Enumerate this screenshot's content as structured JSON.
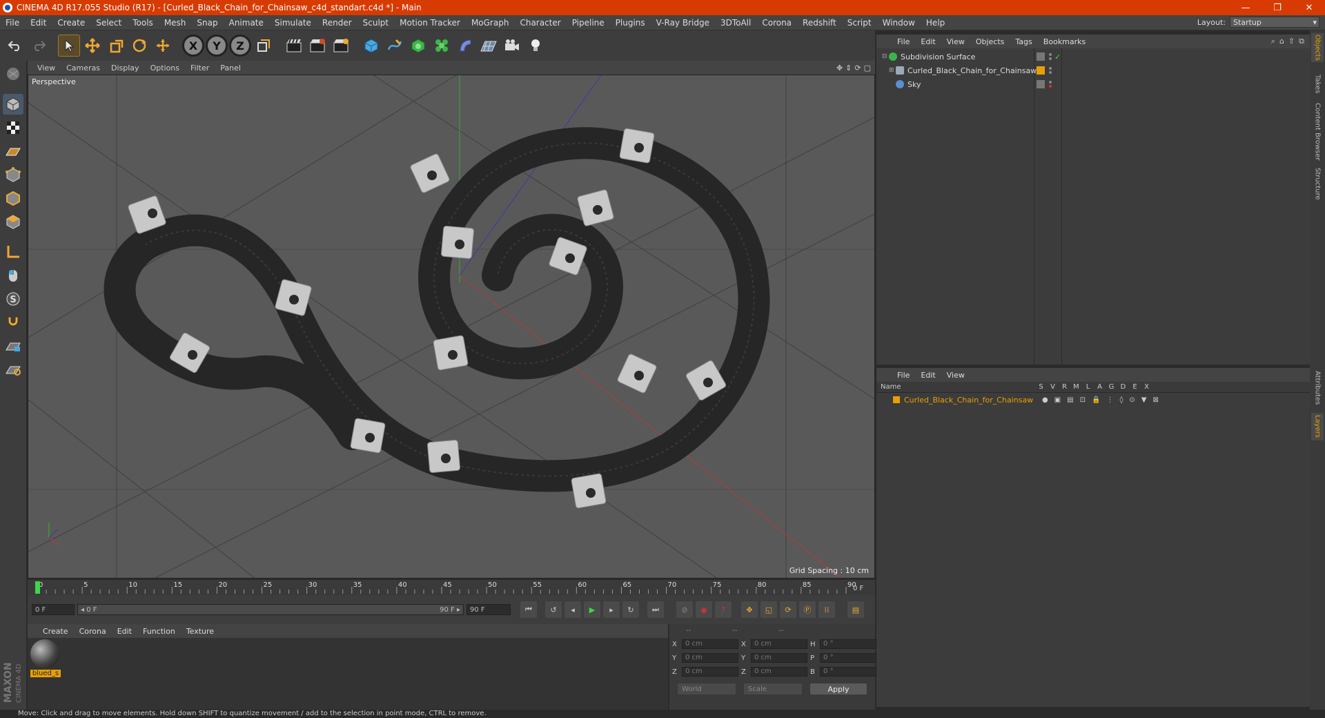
{
  "window": {
    "title": "CINEMA 4D R17.055 Studio (R17) - [Curled_Black_Chain_for_Chainsaw_c4d_standart.c4d *] - Main",
    "minimize": "—",
    "restore": "❐",
    "close": "✕"
  },
  "menubar": {
    "items": [
      "File",
      "Edit",
      "Create",
      "Select",
      "Tools",
      "Mesh",
      "Snap",
      "Animate",
      "Simulate",
      "Render",
      "Sculpt",
      "Motion Tracker",
      "MoGraph",
      "Character",
      "Pipeline",
      "Plugins",
      "V-Ray Bridge",
      "3DToAll",
      "Corona",
      "Redshift",
      "Script",
      "Window",
      "Help"
    ],
    "layout_label": "Layout:",
    "layout_value": "Startup"
  },
  "toolbar": {
    "axis_x": "X",
    "axis_y": "Y",
    "axis_z": "Z"
  },
  "viewport": {
    "menu": [
      "View",
      "Cameras",
      "Display",
      "Options",
      "Filter",
      "Panel"
    ],
    "label": "Perspective",
    "grid_spacing": "Grid Spacing : 10 cm"
  },
  "timeline": {
    "ticks": [
      "0",
      "5",
      "10",
      "15",
      "20",
      "25",
      "30",
      "35",
      "40",
      "45",
      "50",
      "55",
      "60",
      "65",
      "70",
      "75",
      "80",
      "85",
      "90"
    ],
    "end_field": "0 F"
  },
  "playbar": {
    "current": "0 F",
    "range_start": "◂ 0 F",
    "range_end": "90 F ▸",
    "max": "90 F"
  },
  "material_manager": {
    "menu": [
      "Create",
      "Corona",
      "Edit",
      "Function",
      "Texture"
    ],
    "material_name": "blued_s"
  },
  "coordinates": {
    "header": [
      "--",
      "--",
      "--"
    ],
    "rows": [
      {
        "a": "X",
        "av": "0 cm",
        "b": "X",
        "bv": "0 cm",
        "c": "H",
        "cv": "0 °"
      },
      {
        "a": "Y",
        "av": "0 cm",
        "b": "Y",
        "bv": "0 cm",
        "c": "P",
        "cv": "0 °"
      },
      {
        "a": "Z",
        "av": "0 cm",
        "b": "Z",
        "bv": "0 cm",
        "c": "B",
        "cv": "0 °"
      }
    ],
    "world": "World",
    "scale": "Scale",
    "apply": "Apply"
  },
  "object_manager": {
    "menu": [
      "File",
      "Edit",
      "View",
      "Objects",
      "Tags",
      "Bookmarks"
    ],
    "objects": [
      {
        "name": "Subdivision Surface",
        "color": "#39b54a"
      },
      {
        "name": "Curled_Black_Chain_for_Chainsaw",
        "color": "#9ab"
      },
      {
        "name": "Sky",
        "color": "#5a8fd0"
      }
    ]
  },
  "layer_manager": {
    "menu": [
      "File",
      "Edit",
      "View"
    ],
    "columns": [
      "Name",
      "S",
      "V",
      "R",
      "M",
      "L",
      "A",
      "G",
      "D",
      "E",
      "X"
    ],
    "layer_name": "Curled_Black_Chain_for_Chainsaw"
  },
  "right_tabs": [
    "Objects",
    "Takes",
    "Content Browser",
    "Structure",
    "Attributes",
    "Layers"
  ],
  "status": "Move: Click and drag to move elements. Hold down SHIFT to quantize movement / add to the selection in point mode, CTRL to remove.",
  "colors": {
    "titlebar": "#d83b01",
    "accent": "#e8a000"
  }
}
